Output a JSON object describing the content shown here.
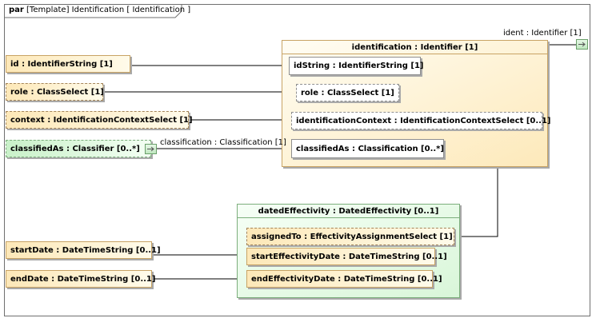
{
  "frame": {
    "keyword": "par",
    "title": "[Template] Identification [ Identification ]"
  },
  "identifier_block": {
    "title": "identification : Identifier [1]",
    "parts": {
      "idString": "idString : IdentifierString [1]",
      "role": "role : ClassSelect [1]",
      "identificationContext": "identificationContext : IdentificationContextSelect [0..1]",
      "classifiedAs": "classifiedAs : Classification [0..*]"
    }
  },
  "ident_port_label": "ident : Identifier [1]",
  "left_properties": {
    "id": "id : IdentifierString [1]",
    "role": "role : ClassSelect [1]",
    "context": "context : IdentificationContextSelect [1]",
    "classifiedAs": "classifiedAs : Classifier [0..*]",
    "startDate": "startDate : DateTimeString [0..1]",
    "endDate": "endDate : DateTimeString [0..1]"
  },
  "connector_labels": {
    "classification": "classification : Classification [1]"
  },
  "effectivity_block": {
    "title": "datedEffectivity : DatedEffectivity [0..1]",
    "parts": {
      "assignedTo": "assignedTo : EffectivityAssignmentSelect [1]",
      "startEffectivityDate": "startEffectivityDate : DateTimeString [0..1]",
      "endEffectivityDate": "endEffectivityDate : DateTimeString [0..1]"
    }
  },
  "colors": {
    "block_yellow": "#fde8b8",
    "block_green": "#c9f1c9",
    "border_yellow": "#c8a364",
    "border_green": "#7cae7c",
    "line": "#000000"
  }
}
